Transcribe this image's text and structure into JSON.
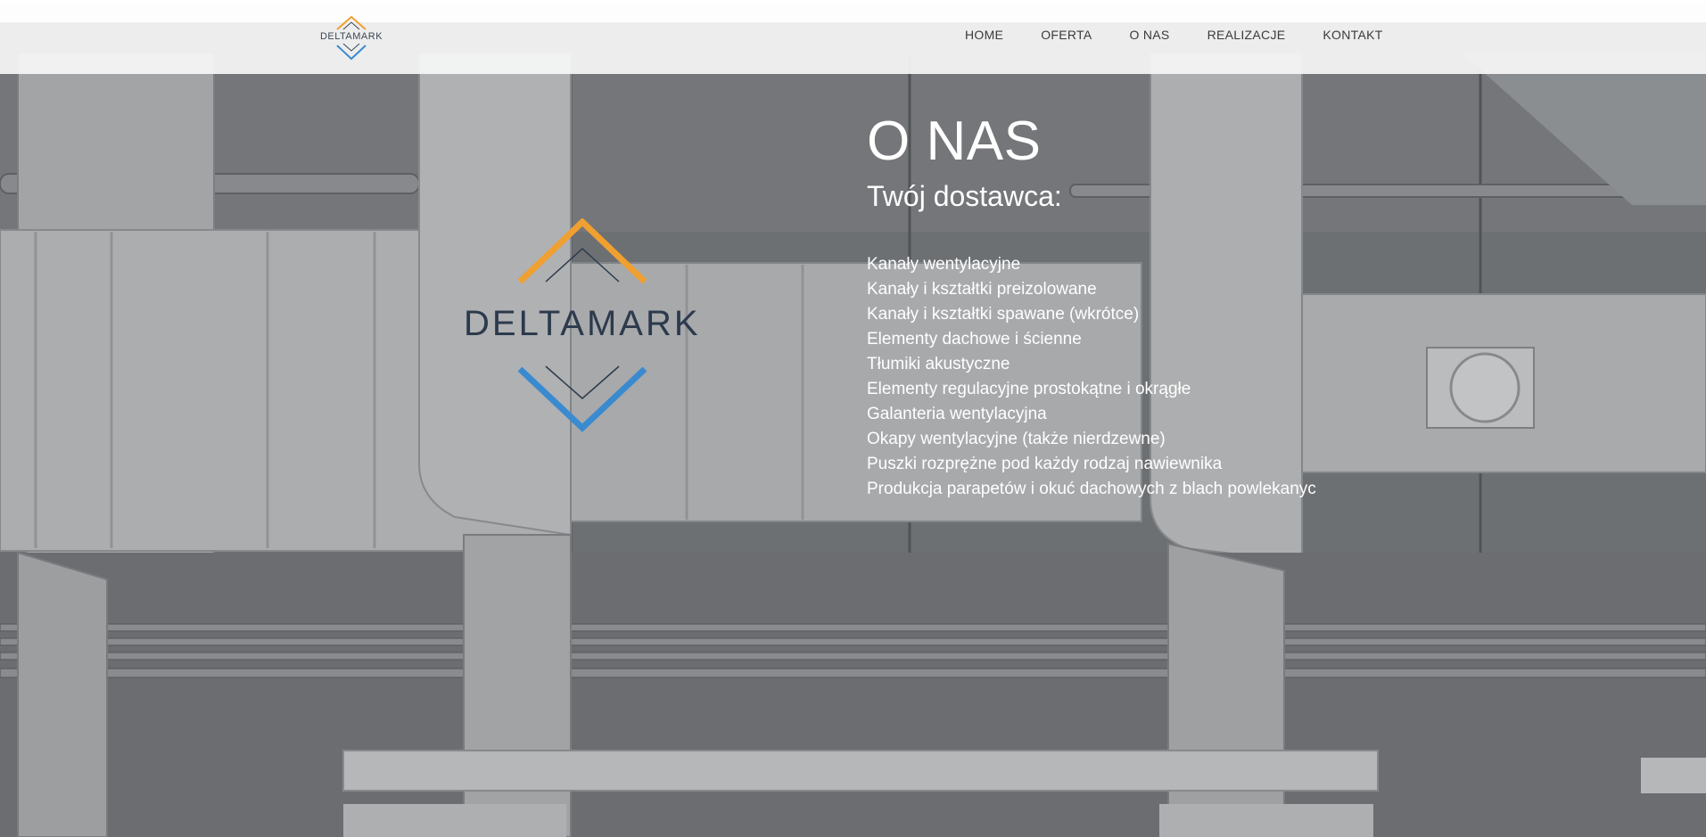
{
  "header": {
    "logo_text": "DELTAMARK",
    "nav": [
      {
        "label": "HOME"
      },
      {
        "label": "OFERTA"
      },
      {
        "label": "O NAS"
      },
      {
        "label": "REALIZACJE"
      },
      {
        "label": "KONTAKT"
      }
    ]
  },
  "hero_logo": {
    "text": "DELTAMARK"
  },
  "about": {
    "title": "O NAS",
    "subtitle": "Twój dostawca:",
    "items": [
      "Kanały wentylacyjne",
      "Kanały i kształtki preizolowane",
      "Kanały i kształtki spawane (wkrótce)",
      "Elementy dachowe i ścienne",
      "Tłumiki akustyczne",
      "Elementy regulacyjne prostokątne i okrągłe",
      "Galanteria wentylacyjna",
      "Okapy wentylacyjne (także nierdzewne)",
      "Puszki rozprężne pod każdy rodzaj nawiewnika",
      "Produkcja parapetów i okuć dachowych z blach powlekanyc"
    ]
  },
  "colors": {
    "logo_orange": "#f0a030",
    "logo_blue": "#3a8ad0",
    "logo_text": "#2c3a4c",
    "header_bg": "#f6f6f6",
    "content_text": "#ffffff"
  }
}
